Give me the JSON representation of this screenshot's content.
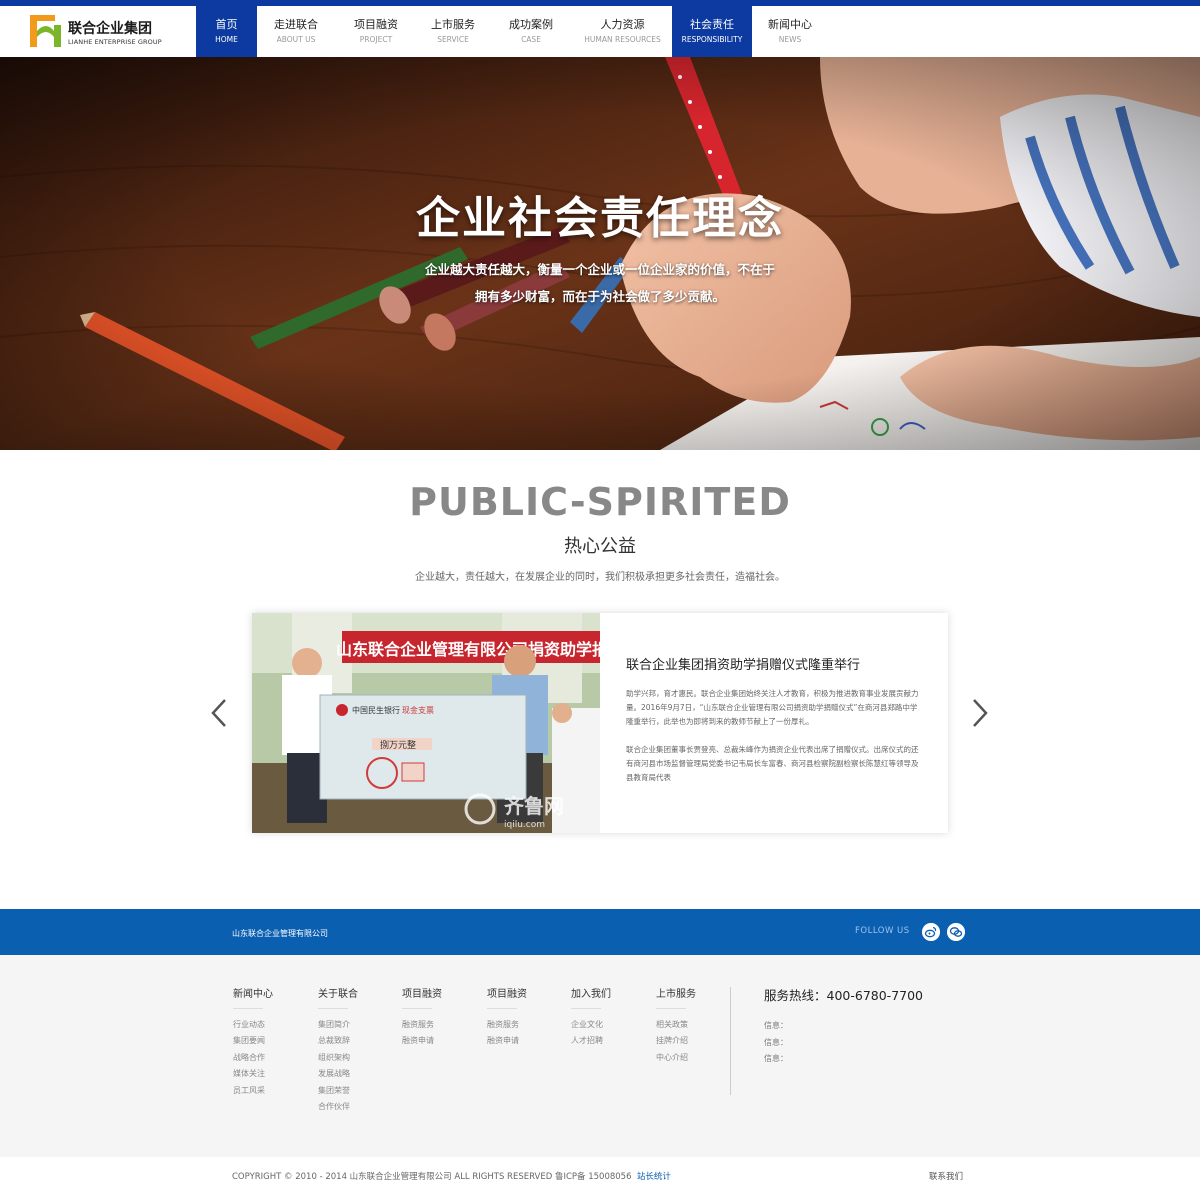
{
  "brand": {
    "name_cn": "联合企业集团",
    "name_en": "LIANHE ENTERPRISE GROUP",
    "colors": {
      "primary": "#0c3aa0",
      "band": "#0b5fb0",
      "logo_orange": "#f29a1c",
      "logo_green": "#7ab52a"
    }
  },
  "nav": [
    {
      "cn": "首页",
      "en": "HOME",
      "active": true
    },
    {
      "cn": "走进联合",
      "en": "ABOUT US"
    },
    {
      "cn": "项目融资",
      "en": "PROJECT"
    },
    {
      "cn": "上市服务",
      "en": "SERVICE"
    },
    {
      "cn": "成功案例",
      "en": "CASE"
    },
    {
      "cn": "人力资源",
      "en": "HUMAN RESOURCES"
    },
    {
      "cn": "社会责任",
      "en": "RESPONSIBILITY",
      "active": true
    },
    {
      "cn": "新闻中心",
      "en": "NEWS"
    }
  ],
  "hero": {
    "title": "企业社会责任理念",
    "line1": "企业越大责任越大，衡量一个企业或一位企业家的价值，不在于",
    "line2": "拥有多少财富，而在于为社会做了多少贡献。"
  },
  "section": {
    "title_en": "PUBLIC-SPIRITED",
    "title_cn": "热心公益",
    "desc": "企业越大，责任越大，在发展企业的同时，我们积极承担更多社会责任，造福社会。"
  },
  "card": {
    "banner_text": "山东联合企业管理有限公司捐资助学捐",
    "cheque_bank": "中国民生银行",
    "cheque_type": "现金支票",
    "cheque_amount": "捌万元整",
    "watermark_cn": "齐鲁网",
    "watermark_en": "iqilu.com",
    "title": "联合企业集团捐资助学捐赠仪式隆重举行",
    "p1": "助学兴邦，育才惠民。联合企业集团始终关注人才教育，积极为推进教育事业发展贡献力量。2016年9月7日，“山东联合企业管理有限公司捐资助学捐赠仪式”在商河县郑路中学隆重举行，此举也为即将到来的教师节献上了一份厚礼。",
    "p2": "联合企业集团董事长贾登亮、总裁朱峰作为捐资企业代表出席了捐赠仪式。出席仪式的还有商河县市场监督管理局党委书记韦局长车富春、商河县检察院副检察长陈慧红等领导及县教育局代表"
  },
  "band": {
    "company": "山东联合企业管理有限公司",
    "follow": "FOLLOW US"
  },
  "footer": {
    "columns": [
      {
        "head": "新闻中心",
        "items": [
          "行业动态",
          "集团要闻",
          "战略合作",
          "媒体关注",
          "员工风采"
        ]
      },
      {
        "head": "关于联合",
        "items": [
          "集团简介",
          "总裁致辞",
          "组织架构",
          "发展战略",
          "集团荣誉",
          "合作伙伴"
        ]
      },
      {
        "head": "项目融资",
        "items": [
          "融资服务",
          "融资申请"
        ]
      },
      {
        "head": "项目融资",
        "items": [
          "融资服务",
          "融资申请"
        ]
      },
      {
        "head": "加入我们",
        "items": [
          "企业文化",
          "人才招聘"
        ]
      },
      {
        "head": "上市服务",
        "items": [
          "相关政策",
          "挂牌介绍",
          "中心介绍"
        ]
      }
    ],
    "hotline": "服务热线：400-6780-7700",
    "info": [
      "信息：",
      "信息：",
      "信息："
    ]
  },
  "bottom": {
    "copyright": "COPYRIGHT © 2010 - 2014 山东联合企业管理有限公司 ALL RIGHTS RESERVED 鲁ICP备 15008056",
    "stat": "站长统计",
    "contact": "联系我们"
  }
}
